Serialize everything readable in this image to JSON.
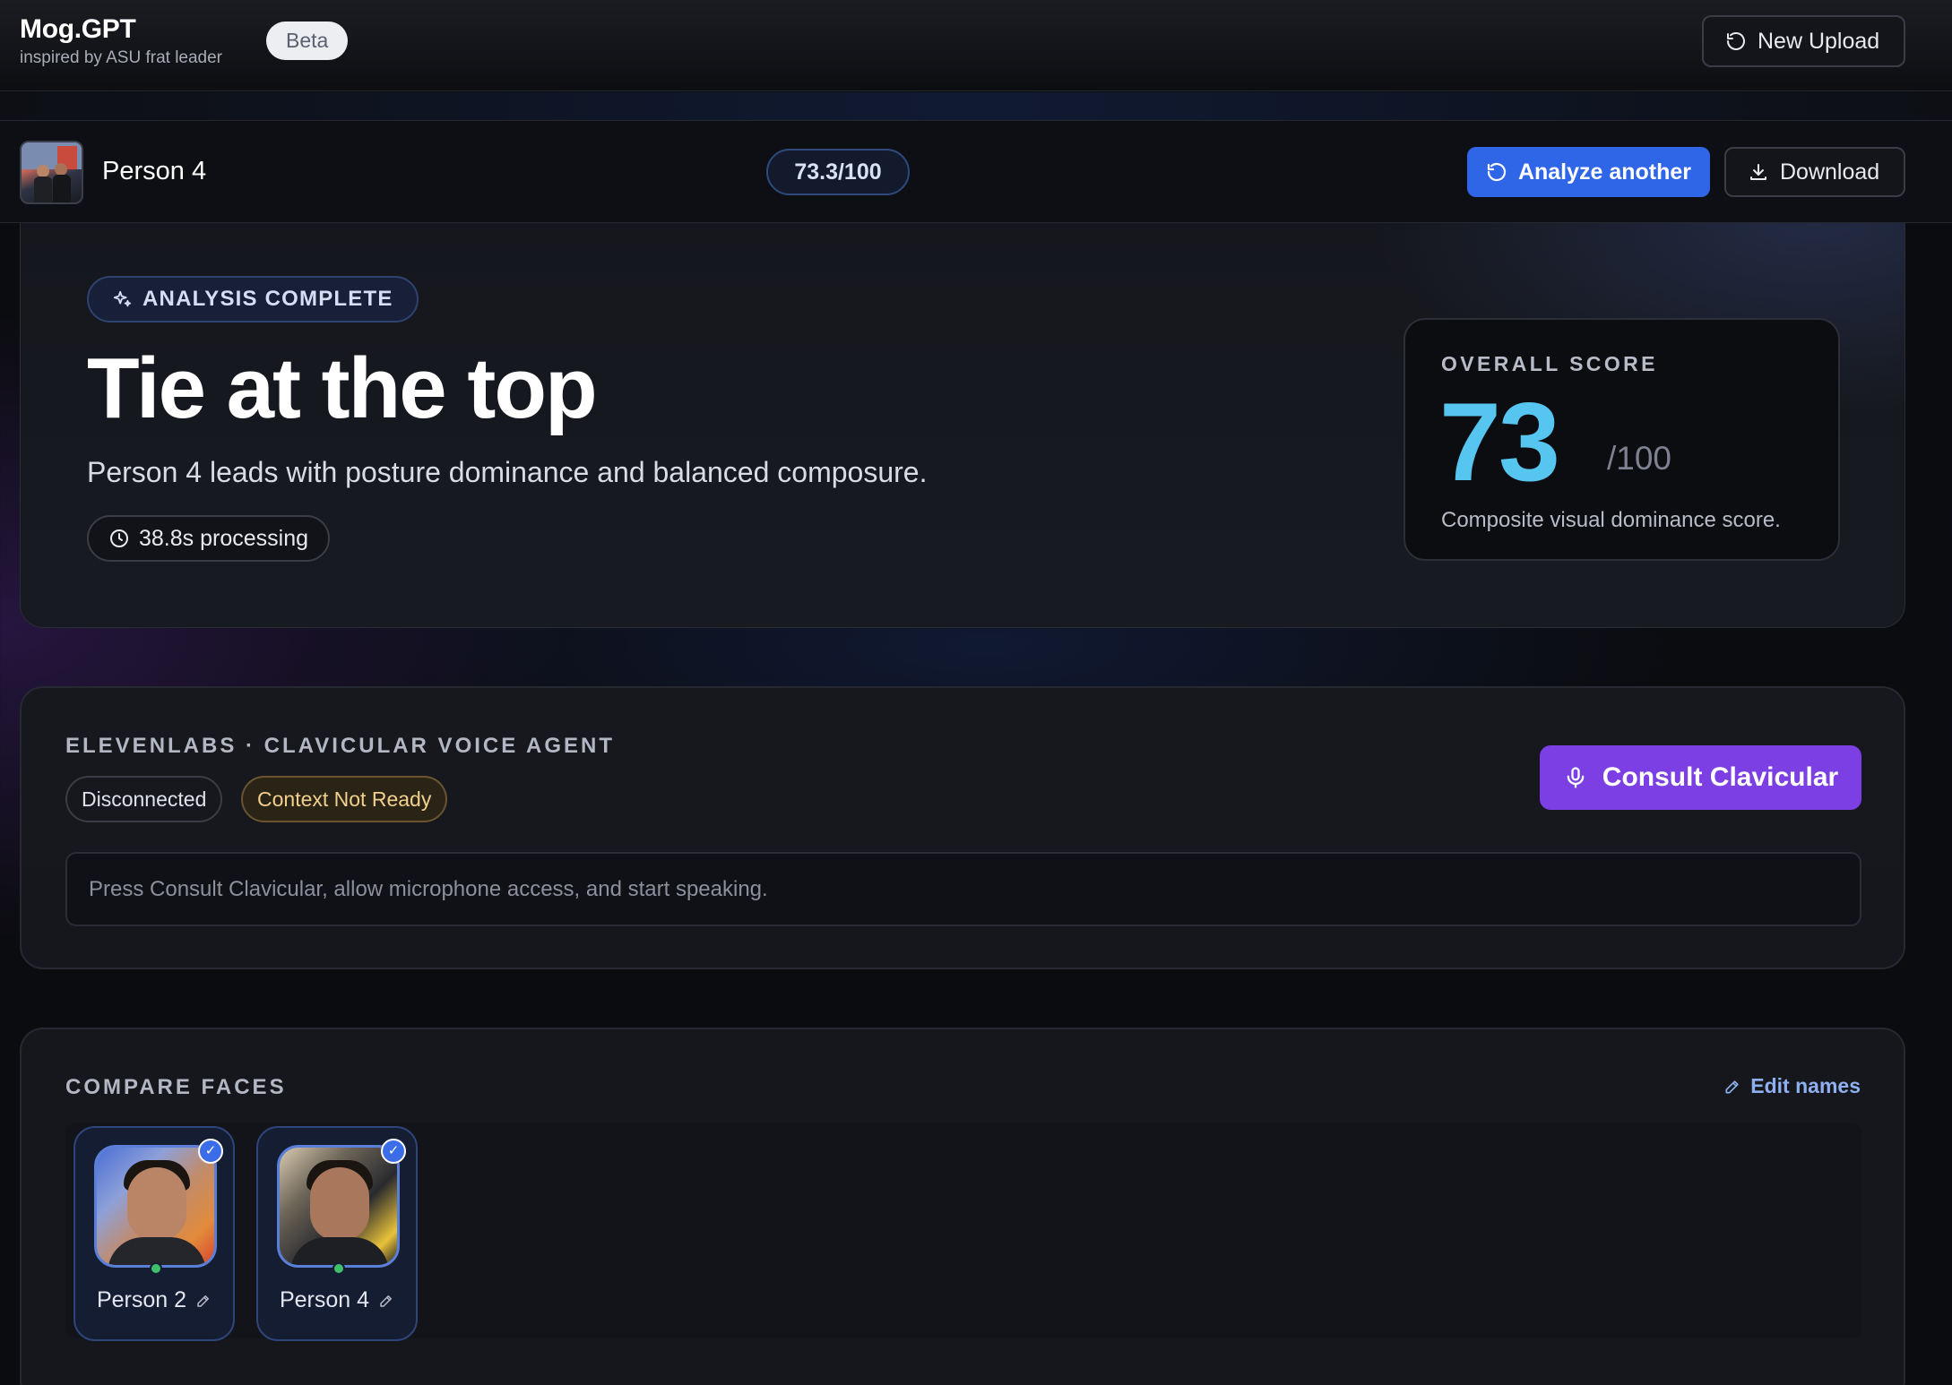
{
  "app": {
    "title": "Mog.GPT",
    "subtitle": "inspired by ASU frat leader",
    "badge": "Beta",
    "new_upload_label": "New Upload"
  },
  "person_bar": {
    "name": "Person 4",
    "score": "73.3/100",
    "analyze_label": "Analyze another",
    "download_label": "Download"
  },
  "hero": {
    "status_badge": "ANALYSIS COMPLETE",
    "title": "Tie at the top",
    "subtitle": "Person 4 leads with posture dominance and balanced composure.",
    "processing": "38.8s processing",
    "score_card": {
      "label": "OVERALL SCORE",
      "value": "73",
      "denominator": "/100",
      "caption": "Composite visual dominance score."
    }
  },
  "voice_agent": {
    "label": "ELEVENLABS · CLAVICULAR VOICE AGENT",
    "status_connection": "Disconnected",
    "status_context": "Context Not Ready",
    "consult_label": "Consult Clavicular",
    "prompt": "Press Consult Clavicular, allow microphone access, and start speaking."
  },
  "compare": {
    "label": "COMPARE FACES",
    "edit_label": "Edit names",
    "faces": [
      {
        "name": "Person 2",
        "selected": true,
        "online": true
      },
      {
        "name": "Person 4",
        "selected": true,
        "online": true
      }
    ]
  },
  "colors": {
    "primary": "#2f66e8",
    "consult": "#7b3fe4",
    "score": "#56c6f0",
    "warning_text": "#f2d08c",
    "online": "#3fbf6a"
  },
  "icons": {
    "new_upload": "refresh-icon",
    "analyze": "refresh-icon",
    "download": "download-icon",
    "status": "sparkle-icon",
    "processing": "clock-icon",
    "consult": "microphone-icon",
    "edit": "pencil-icon"
  }
}
